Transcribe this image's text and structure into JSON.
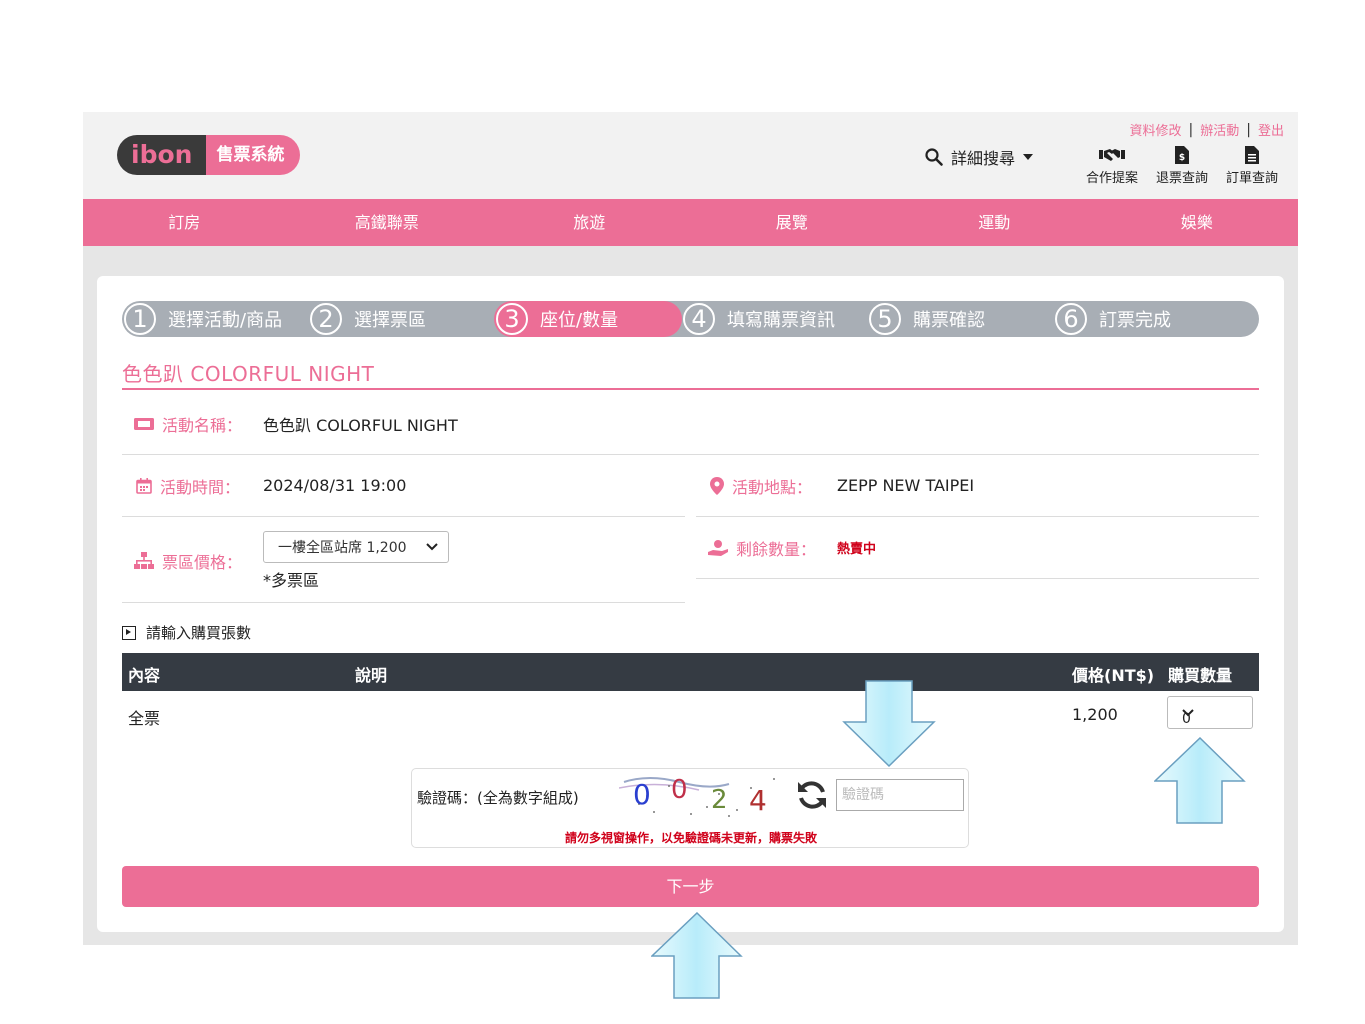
{
  "header": {
    "logo_ibon": "ibon",
    "logo_system": "售票系統",
    "search_label": "詳細搜尋",
    "top_links": [
      "資料修改",
      "辦活動",
      "登出"
    ],
    "tools": [
      {
        "label": "合作提案",
        "icon": "handshake-icon"
      },
      {
        "label": "退票查詢",
        "icon": "refund-document-icon"
      },
      {
        "label": "訂單查詢",
        "icon": "order-document-icon"
      }
    ]
  },
  "nav": [
    "訂房",
    "高鐵聯票",
    "旅遊",
    "展覽",
    "運動",
    "娛樂"
  ],
  "steps": [
    {
      "num": "1",
      "label": "選擇活動/商品"
    },
    {
      "num": "2",
      "label": "選擇票區"
    },
    {
      "num": "3",
      "label": "座位/數量"
    },
    {
      "num": "4",
      "label": "填寫購票資訊"
    },
    {
      "num": "5",
      "label": "購票確認"
    },
    {
      "num": "6",
      "label": "訂票完成"
    }
  ],
  "active_step": 3,
  "event": {
    "title": "色色趴 COLORFUL NIGHT",
    "name_label": "活動名稱：",
    "name_value": "色色趴 COLORFUL NIGHT",
    "time_label": "活動時間：",
    "time_value": "2024/08/31 19:00",
    "place_label": "活動地點：",
    "place_value": "ZEPP NEW TAIPEI",
    "price_label": "票區價格：",
    "price_selected": "一樓全區站席 1,200",
    "price_note": "*多票區",
    "remain_label": "剩餘數量：",
    "remain_value": "熱賣中"
  },
  "quantity": {
    "heading": "請輸入購買張數",
    "columns": [
      "內容",
      "說明",
      "價格(NT$)",
      "購買數量"
    ],
    "rows": [
      {
        "content": "全票",
        "desc": "",
        "price": "1,200",
        "qty": "0"
      }
    ]
  },
  "captcha": {
    "label": "驗證碼：(全為數字組成)",
    "digits": [
      "0",
      "0",
      "2",
      "4"
    ],
    "placeholder": "驗證碼",
    "warning": "請勿多視窗操作，以免驗證碼未更新，購票失敗"
  },
  "next_button": "下一步",
  "colors": {
    "accent": "#ec6e96",
    "table_header": "#353b43",
    "warning": "#d0021b",
    "arrow": "#c9f0fb"
  }
}
